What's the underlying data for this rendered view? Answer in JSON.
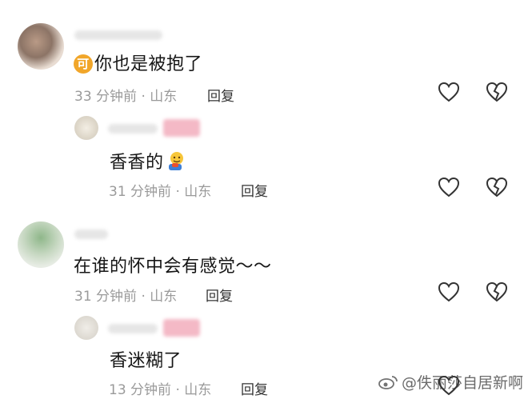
{
  "comments": [
    {
      "text": "你也是被抱了",
      "badge": "可",
      "time_location": "33 分钟前 · 山东",
      "reply_label": "回复"
    },
    {
      "text": "香香的",
      "time_location": "31 分钟前 · 山东",
      "reply_label": "回复"
    },
    {
      "text": "在谁的怀中会有感觉～～",
      "time_location": "31 分钟前 · 山东",
      "reply_label": "回复"
    },
    {
      "text": "香迷糊了",
      "time_location": "13 分钟前 · 山东",
      "reply_label": "回复"
    }
  ],
  "watermark": "@佚丽莎自居新啊",
  "icons": {
    "like": "heart-outline-icon",
    "dislike": "broken-heart-icon",
    "badge": "orange-circle-badge",
    "emoji": "blushing-face-emoji",
    "weibo": "weibo-logo-icon"
  },
  "colors": {
    "text": "#161616",
    "meta": "#9a9a9a",
    "badge": "#f1a62a",
    "tag": "#f4b9c6"
  }
}
